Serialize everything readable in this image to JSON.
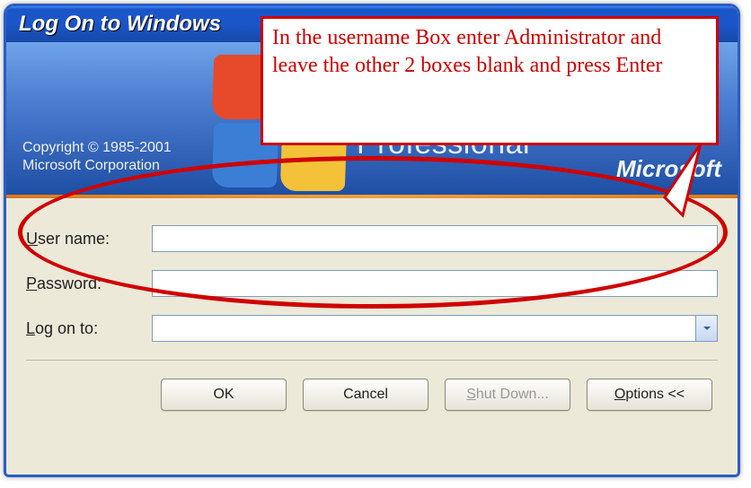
{
  "window": {
    "title": "Log On to Windows"
  },
  "banner": {
    "copyright_line1": "Copyright © 1985-2001",
    "copyright_line2": "Microsoft Corporation",
    "edition": "Professional",
    "brand": "Microsoft"
  },
  "form": {
    "username_label": "User name:",
    "username_value": "",
    "password_label": "Password:",
    "password_value": "",
    "domain_label": "Log on to:",
    "domain_value": ""
  },
  "buttons": {
    "ok": "OK",
    "cancel": "Cancel",
    "shutdown": "Shut Down...",
    "options": "Options <<"
  },
  "underline": {
    "u": "U",
    "p": "P",
    "l": "L",
    "s": "S",
    "o": "O"
  },
  "annotation": {
    "text": "In the username Box enter Administrator and leave the other 2 boxes blank and press Enter"
  }
}
